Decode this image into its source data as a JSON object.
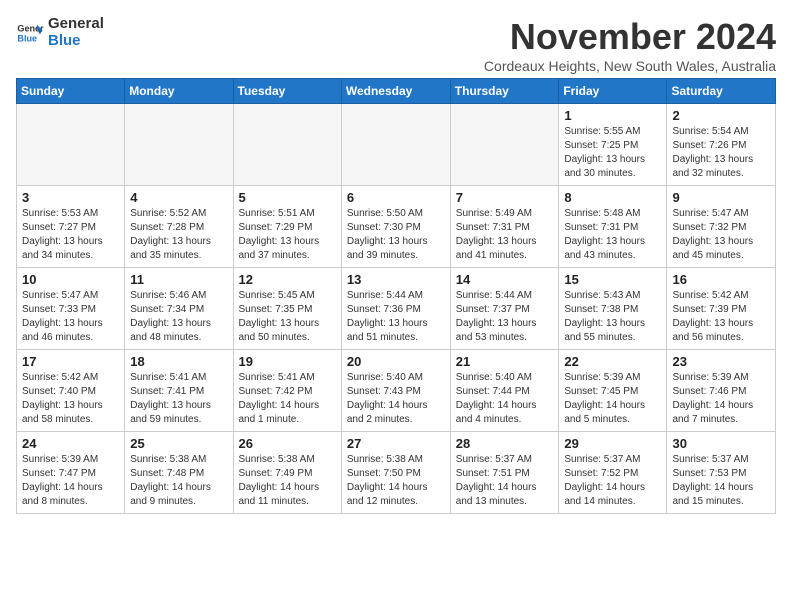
{
  "logo": {
    "line1": "General",
    "line2": "Blue"
  },
  "title": "November 2024",
  "location": "Cordeaux Heights, New South Wales, Australia",
  "days_of_week": [
    "Sunday",
    "Monday",
    "Tuesday",
    "Wednesday",
    "Thursday",
    "Friday",
    "Saturday"
  ],
  "weeks": [
    [
      {
        "day": "",
        "detail": ""
      },
      {
        "day": "",
        "detail": ""
      },
      {
        "day": "",
        "detail": ""
      },
      {
        "day": "",
        "detail": ""
      },
      {
        "day": "",
        "detail": ""
      },
      {
        "day": "1",
        "detail": "Sunrise: 5:55 AM\nSunset: 7:25 PM\nDaylight: 13 hours\nand 30 minutes."
      },
      {
        "day": "2",
        "detail": "Sunrise: 5:54 AM\nSunset: 7:26 PM\nDaylight: 13 hours\nand 32 minutes."
      }
    ],
    [
      {
        "day": "3",
        "detail": "Sunrise: 5:53 AM\nSunset: 7:27 PM\nDaylight: 13 hours\nand 34 minutes."
      },
      {
        "day": "4",
        "detail": "Sunrise: 5:52 AM\nSunset: 7:28 PM\nDaylight: 13 hours\nand 35 minutes."
      },
      {
        "day": "5",
        "detail": "Sunrise: 5:51 AM\nSunset: 7:29 PM\nDaylight: 13 hours\nand 37 minutes."
      },
      {
        "day": "6",
        "detail": "Sunrise: 5:50 AM\nSunset: 7:30 PM\nDaylight: 13 hours\nand 39 minutes."
      },
      {
        "day": "7",
        "detail": "Sunrise: 5:49 AM\nSunset: 7:31 PM\nDaylight: 13 hours\nand 41 minutes."
      },
      {
        "day": "8",
        "detail": "Sunrise: 5:48 AM\nSunset: 7:31 PM\nDaylight: 13 hours\nand 43 minutes."
      },
      {
        "day": "9",
        "detail": "Sunrise: 5:47 AM\nSunset: 7:32 PM\nDaylight: 13 hours\nand 45 minutes."
      }
    ],
    [
      {
        "day": "10",
        "detail": "Sunrise: 5:47 AM\nSunset: 7:33 PM\nDaylight: 13 hours\nand 46 minutes."
      },
      {
        "day": "11",
        "detail": "Sunrise: 5:46 AM\nSunset: 7:34 PM\nDaylight: 13 hours\nand 48 minutes."
      },
      {
        "day": "12",
        "detail": "Sunrise: 5:45 AM\nSunset: 7:35 PM\nDaylight: 13 hours\nand 50 minutes."
      },
      {
        "day": "13",
        "detail": "Sunrise: 5:44 AM\nSunset: 7:36 PM\nDaylight: 13 hours\nand 51 minutes."
      },
      {
        "day": "14",
        "detail": "Sunrise: 5:44 AM\nSunset: 7:37 PM\nDaylight: 13 hours\nand 53 minutes."
      },
      {
        "day": "15",
        "detail": "Sunrise: 5:43 AM\nSunset: 7:38 PM\nDaylight: 13 hours\nand 55 minutes."
      },
      {
        "day": "16",
        "detail": "Sunrise: 5:42 AM\nSunset: 7:39 PM\nDaylight: 13 hours\nand 56 minutes."
      }
    ],
    [
      {
        "day": "17",
        "detail": "Sunrise: 5:42 AM\nSunset: 7:40 PM\nDaylight: 13 hours\nand 58 minutes."
      },
      {
        "day": "18",
        "detail": "Sunrise: 5:41 AM\nSunset: 7:41 PM\nDaylight: 13 hours\nand 59 minutes."
      },
      {
        "day": "19",
        "detail": "Sunrise: 5:41 AM\nSunset: 7:42 PM\nDaylight: 14 hours\nand 1 minute."
      },
      {
        "day": "20",
        "detail": "Sunrise: 5:40 AM\nSunset: 7:43 PM\nDaylight: 14 hours\nand 2 minutes."
      },
      {
        "day": "21",
        "detail": "Sunrise: 5:40 AM\nSunset: 7:44 PM\nDaylight: 14 hours\nand 4 minutes."
      },
      {
        "day": "22",
        "detail": "Sunrise: 5:39 AM\nSunset: 7:45 PM\nDaylight: 14 hours\nand 5 minutes."
      },
      {
        "day": "23",
        "detail": "Sunrise: 5:39 AM\nSunset: 7:46 PM\nDaylight: 14 hours\nand 7 minutes."
      }
    ],
    [
      {
        "day": "24",
        "detail": "Sunrise: 5:39 AM\nSunset: 7:47 PM\nDaylight: 14 hours\nand 8 minutes."
      },
      {
        "day": "25",
        "detail": "Sunrise: 5:38 AM\nSunset: 7:48 PM\nDaylight: 14 hours\nand 9 minutes."
      },
      {
        "day": "26",
        "detail": "Sunrise: 5:38 AM\nSunset: 7:49 PM\nDaylight: 14 hours\nand 11 minutes."
      },
      {
        "day": "27",
        "detail": "Sunrise: 5:38 AM\nSunset: 7:50 PM\nDaylight: 14 hours\nand 12 minutes."
      },
      {
        "day": "28",
        "detail": "Sunrise: 5:37 AM\nSunset: 7:51 PM\nDaylight: 14 hours\nand 13 minutes."
      },
      {
        "day": "29",
        "detail": "Sunrise: 5:37 AM\nSunset: 7:52 PM\nDaylight: 14 hours\nand 14 minutes."
      },
      {
        "day": "30",
        "detail": "Sunrise: 5:37 AM\nSunset: 7:53 PM\nDaylight: 14 hours\nand 15 minutes."
      }
    ]
  ]
}
